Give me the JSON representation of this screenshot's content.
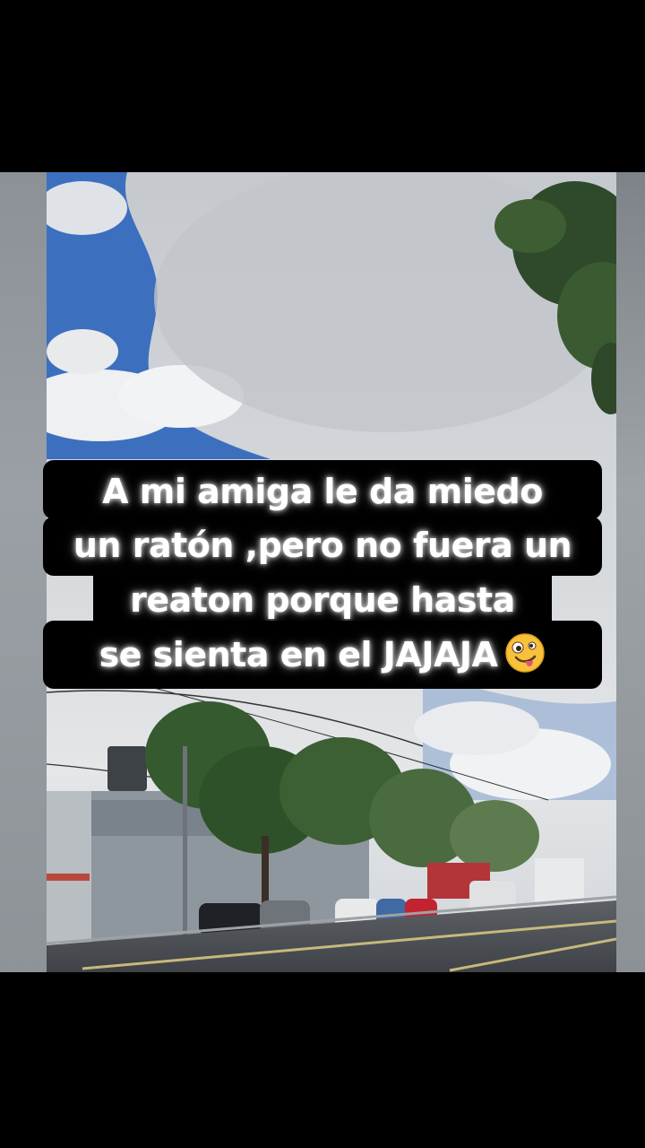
{
  "caption": {
    "line1": "A mi amiga le da miedo",
    "line2": "un ratón ,pero no fuera un",
    "line3": "reaton porque hasta",
    "line4": "se sienta en el JAJAJA",
    "emoji": "zany-face-emoji"
  },
  "colors": {
    "caption_background": "#000000",
    "caption_text": "#ffffff",
    "sky_blue": "#3d6fbf"
  }
}
